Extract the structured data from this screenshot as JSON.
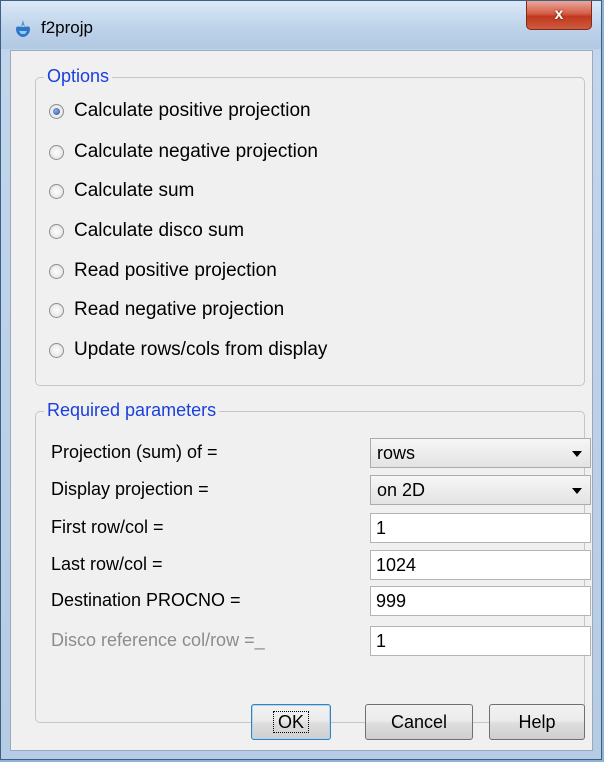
{
  "window": {
    "title": "f2projp",
    "close_label": "x"
  },
  "options": {
    "group_title": "Options",
    "items": [
      {
        "label": "Calculate positive projection",
        "selected": true
      },
      {
        "label": "Calculate negative projection",
        "selected": false
      },
      {
        "label": "Calculate sum",
        "selected": false
      },
      {
        "label": "Calculate disco sum",
        "selected": false
      },
      {
        "label": "Read positive projection",
        "selected": false
      },
      {
        "label": "Read negative projection",
        "selected": false
      },
      {
        "label": "Update rows/cols from display",
        "selected": false
      }
    ]
  },
  "params": {
    "group_title": "Required parameters",
    "projection_sum_of": {
      "label": "Projection (sum) of =",
      "value": "rows"
    },
    "display_projection": {
      "label": "Display projection =",
      "value": "on 2D"
    },
    "first_rowcol": {
      "label": "First row/col =",
      "value": "1"
    },
    "last_rowcol": {
      "label": "Last row/col =",
      "value": "1024"
    },
    "destination_procno": {
      "label": "Destination PROCNO =",
      "value": "999"
    },
    "disco_reference": {
      "label": "Disco reference col/row =_",
      "value": "1"
    }
  },
  "buttons": {
    "ok": "OK",
    "cancel": "Cancel",
    "help": "Help"
  },
  "icons": {
    "app": "topspin-app-icon",
    "close": "close-icon",
    "dropdown": "chevron-down-icon"
  }
}
